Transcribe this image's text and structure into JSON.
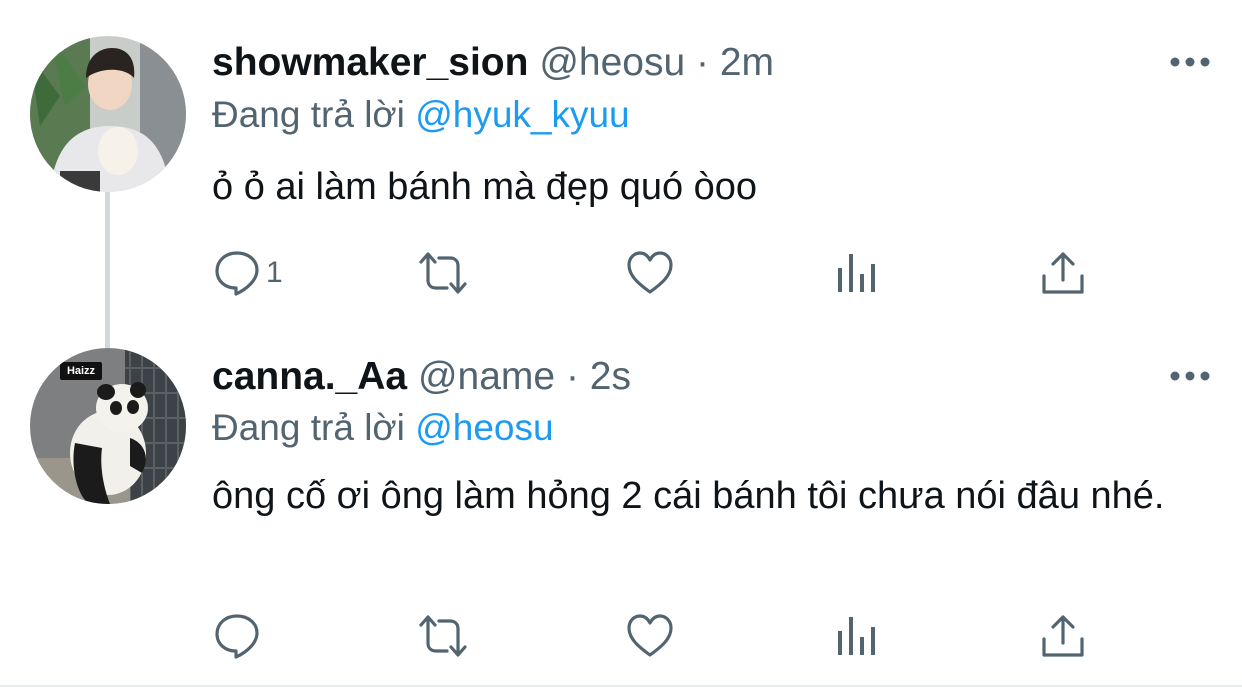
{
  "tweets": [
    {
      "display_name": "showmaker_sion",
      "handle": "@heosu",
      "separator": "·",
      "time": "2m",
      "reply_prefix": "Đang trả lời",
      "reply_to": "@hyuk_kyuu",
      "text": "ỏ ỏ ai làm bánh mà đẹp quó òoo",
      "reply_count": "1",
      "avatar": "person-holding-plush"
    },
    {
      "display_name": "canna._Aa",
      "handle": "@name",
      "separator": "·",
      "time": "2s",
      "reply_prefix": "Đang trả lời",
      "reply_to": "@heosu",
      "text": "ông cố ơi ông làm hỏng 2 cái bánh tôi chưa nói đâu nhé.",
      "reply_count": "",
      "avatar_badge": "Haizz",
      "avatar": "panda"
    }
  ],
  "icons": {
    "reply": "speech-bubble-icon",
    "retweet": "retweet-icon",
    "like": "heart-icon",
    "views": "bar-chart-icon",
    "share": "share-icon",
    "more": "ellipsis-icon"
  },
  "colors": {
    "text_primary": "#0f1419",
    "text_secondary": "#536471",
    "link": "#1d9bf0",
    "thread_line": "#cfd9de"
  }
}
